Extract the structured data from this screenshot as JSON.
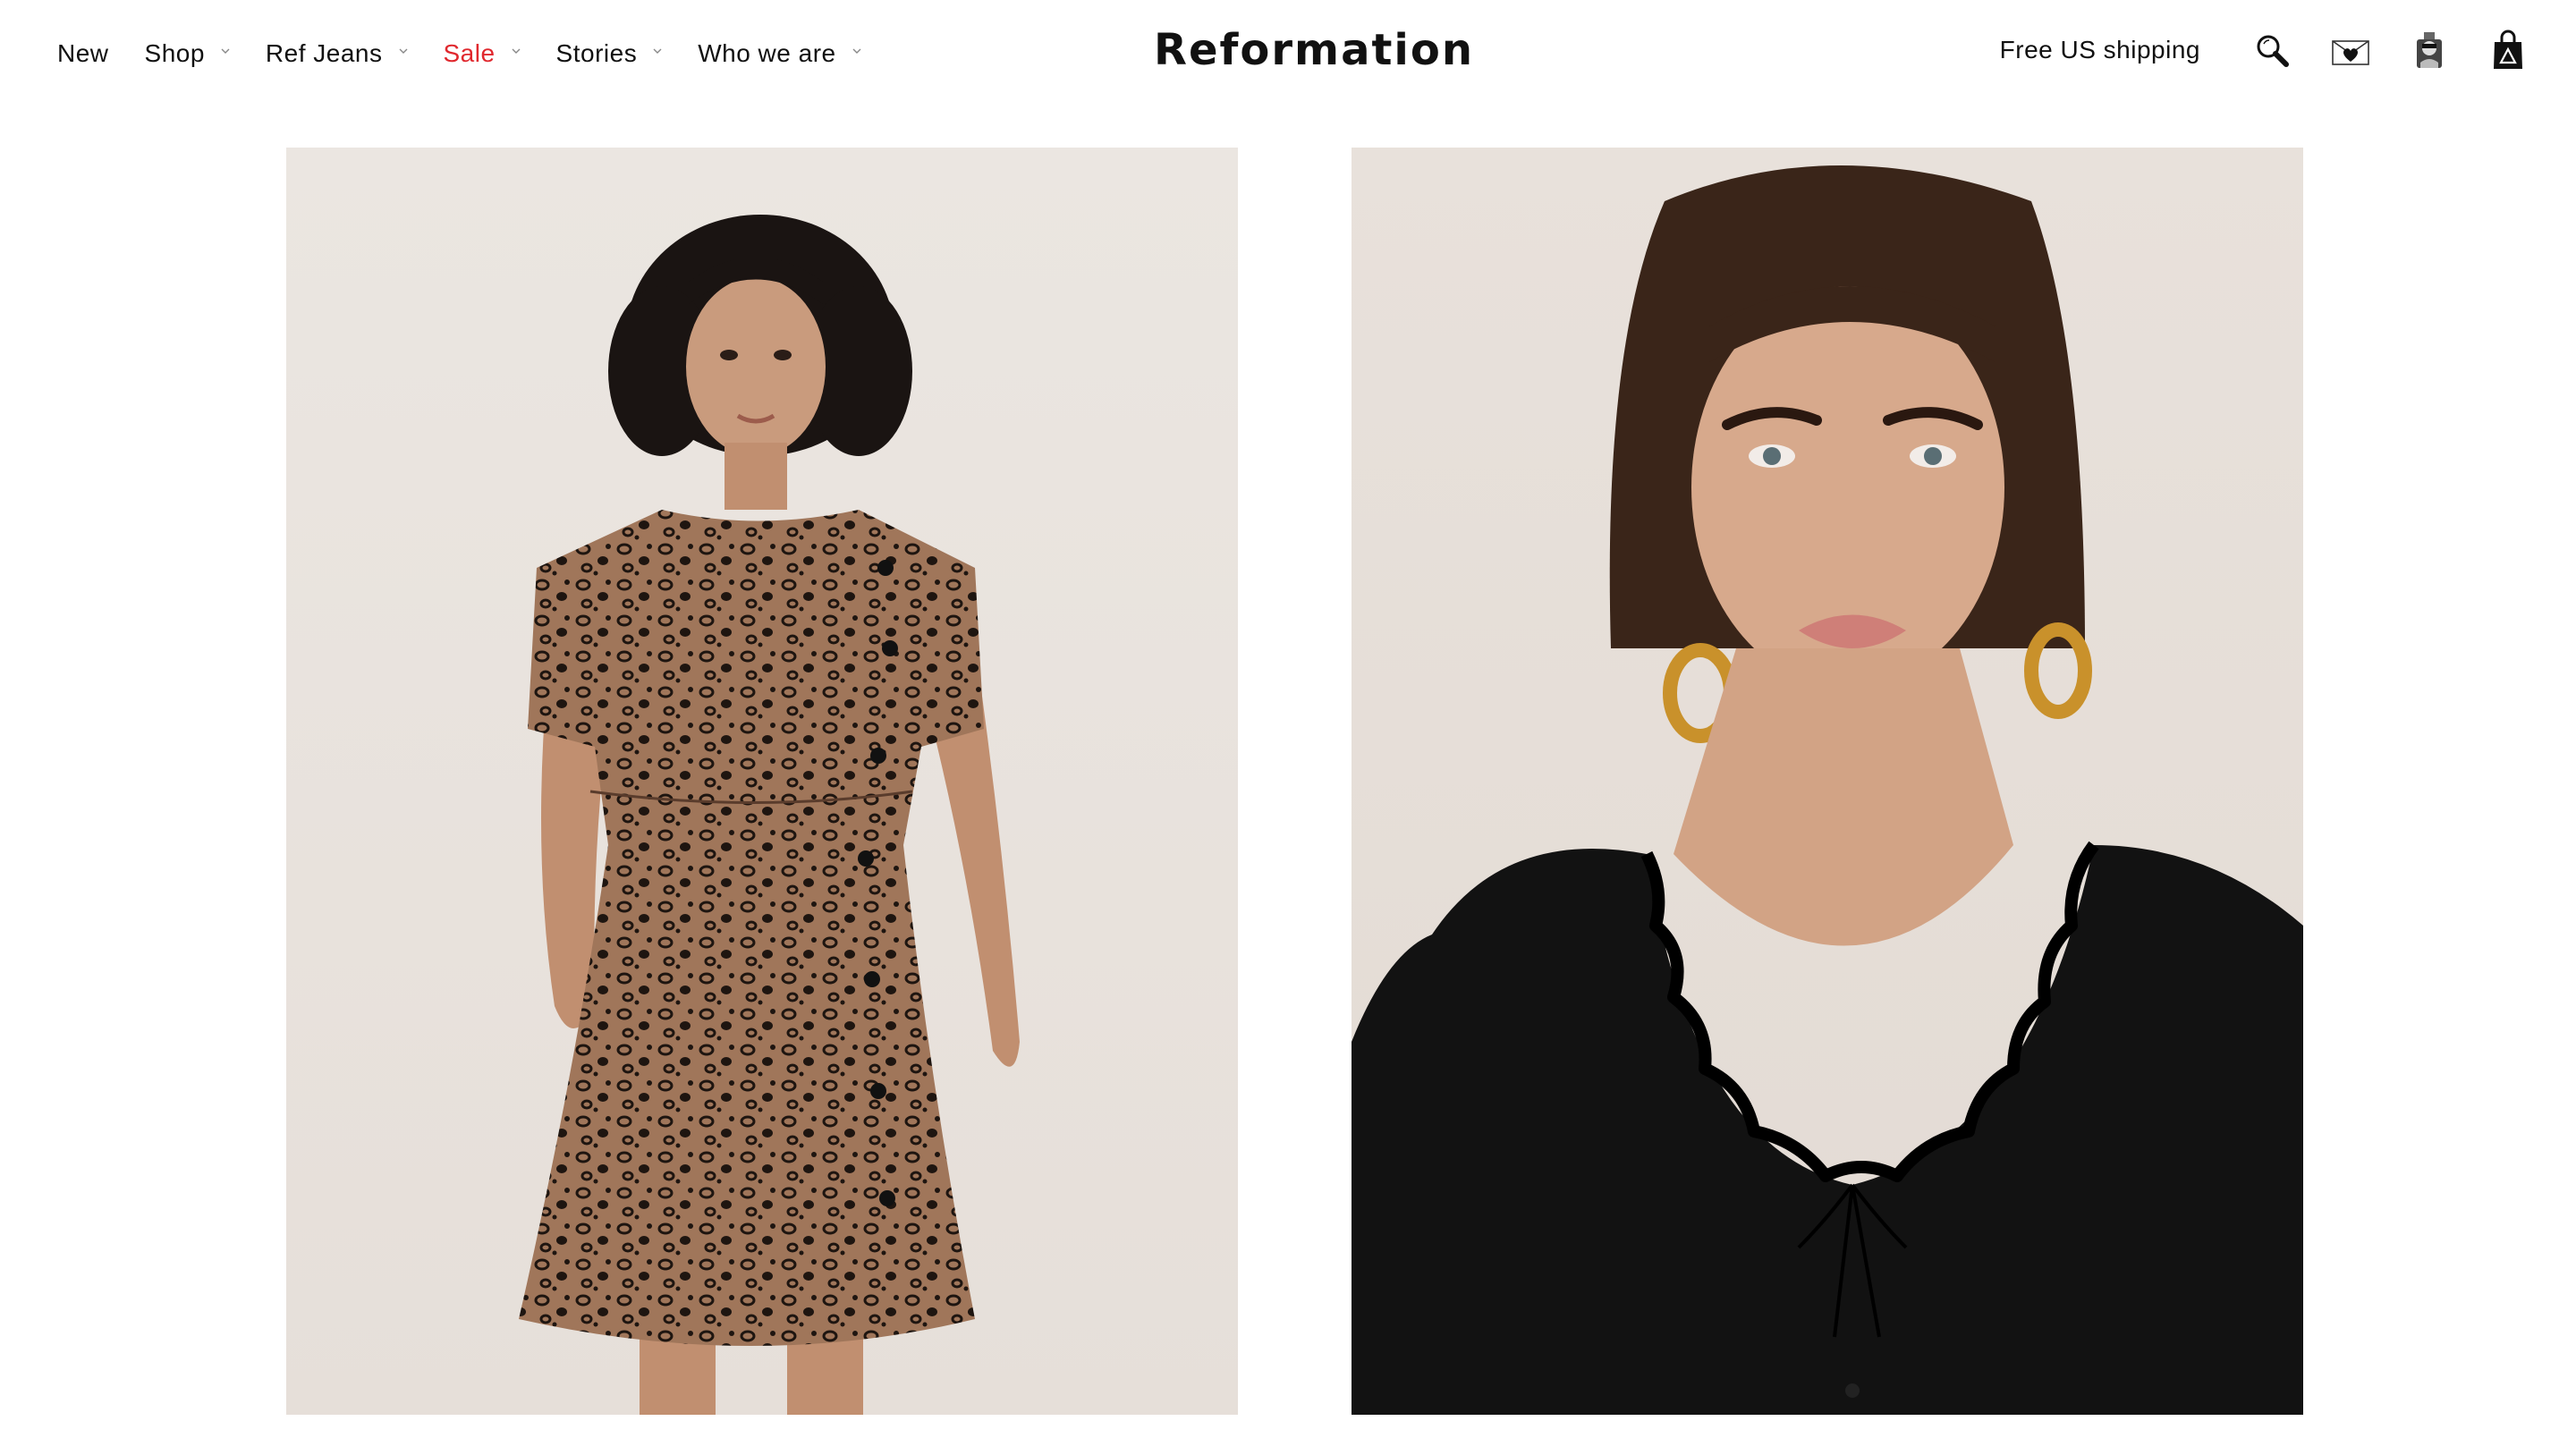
{
  "nav": {
    "items": [
      {
        "label": "New",
        "has_dropdown": false
      },
      {
        "label": "Shop",
        "has_dropdown": true
      },
      {
        "label": "Ref Jeans",
        "has_dropdown": true
      },
      {
        "label": "Sale",
        "has_dropdown": true,
        "color": "#e0282e"
      },
      {
        "label": "Stories",
        "has_dropdown": true
      },
      {
        "label": "Who we are",
        "has_dropdown": true
      }
    ]
  },
  "brand": {
    "logo_text": "Reformation"
  },
  "utility": {
    "shipping_text": "Free US shipping",
    "icons": [
      "search-icon",
      "wishlist-envelope-icon",
      "account-icon",
      "shopping-bag-icon"
    ]
  },
  "products": [
    {
      "image": "model-leopard-print-mini-dress"
    },
    {
      "image": "model-black-ruffle-top"
    }
  ],
  "colors": {
    "text": "#111111",
    "sale": "#e0282e",
    "image_bg": "#e9e3de"
  }
}
